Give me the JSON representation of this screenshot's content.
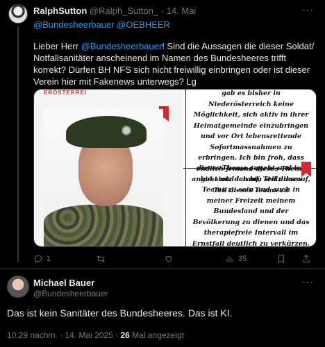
{
  "reply": {
    "author_name": "RalphSutton",
    "author_handle": "@Ralph_Sutton_",
    "separator": "·",
    "date": "14. Mai",
    "more": "···",
    "mentions": "@Bundesheerbauer @OEBHEER",
    "body_prefix": "Lieber Herr ",
    "body_mention": "@Bundesheerbauer",
    "body_rest": "! Sind die Aussagen die dieser Soldat/ Notfallsanitäter anscheinend im Namen des Bundesheeres trifft korrekt? Dürfen BH NFS sich nicht freiwillig einbringen oder ist dieser Verein hier mit Fakenews unterwegs? Lg",
    "media": {
      "seal_text": "ERÖSTERREI",
      "panel_top_text": "gab es bisher in Niederösterreich keine Möglichkeit, sich aktiv in ihrer Heimatgemeinde einzubringen und vor Ort lebensrettende Sofortmassnahmen zu erbringen. Ich bin froh, dass endlich jemand dieses Thema angeht und ich bin stolz darauf, Teil dieses Teams zu",
      "panel_bottom_text": "dieses Thema angeht und ich bin stolz darauf, Teil dieses Teams zu sein und auch in meiner Freizeit meinem Bundesland und der Bevölkerung zu dienen und das therapiefreie Intervall im Ernstfall deutlich zu verkürzen. Gerade bei mir daheim sind die Wege lang und"
    },
    "actions": {
      "replies": "1",
      "reposts": "",
      "likes": "",
      "views": "35"
    }
  },
  "main": {
    "author_name": "Michael Bauer",
    "author_handle": "@Bundesheerbauer",
    "more": "···",
    "body": "Das ist kein Sanitäter des Bundesheeres. Das ist KI.",
    "time": "10:29 nachm.",
    "separator": "·",
    "date": "14. Mai 2025",
    "views_count": "26",
    "views_label": "Mal angezeigt"
  }
}
